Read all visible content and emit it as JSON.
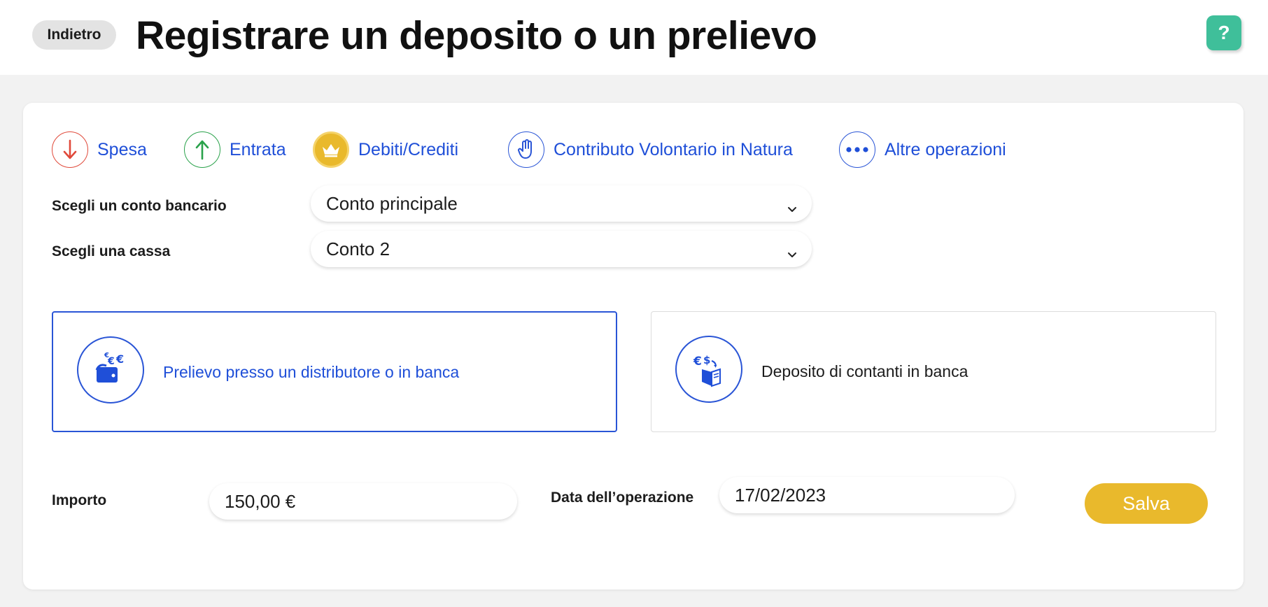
{
  "header": {
    "back_label": "Indietro",
    "title": "Registrare un deposito o un prelievo",
    "help_label": "?"
  },
  "operation_tabs": [
    {
      "label": "Spesa",
      "icon": "arrow-down-icon",
      "color": "#e0493a"
    },
    {
      "label": "Entrata",
      "icon": "arrow-up-icon",
      "color": "#2aa24b"
    },
    {
      "label": "Debiti/Crediti",
      "icon": "crown-icon",
      "color": "#e9b92c"
    },
    {
      "label": "Contributo Volontario in Natura",
      "icon": "hand-icon",
      "color": "#2a55d6"
    },
    {
      "label": "Altre operazioni",
      "icon": "more-dots-icon",
      "color": "#2a55d6"
    }
  ],
  "form": {
    "bank_account_label": "Scegli un conto bancario",
    "bank_account_value": "Conto principale",
    "cash_label": "Scegli una cassa",
    "cash_value": "Conto 2"
  },
  "choices": [
    {
      "label": "Prelievo presso un distributore o in banca",
      "icon": "wallet-withdraw-icon",
      "selected": true
    },
    {
      "label": "Deposito di contanti in banca",
      "icon": "cash-deposit-icon",
      "selected": false
    }
  ],
  "amount": {
    "label": "Importo",
    "value": "150,00 €"
  },
  "date": {
    "label": "Data dell’operazione",
    "value": "17/02/2023"
  },
  "save_label": "Salva",
  "colors": {
    "accent_blue": "#2a55d6",
    "save_yellow": "#e9b92c",
    "help_green": "#3fbf9a"
  }
}
